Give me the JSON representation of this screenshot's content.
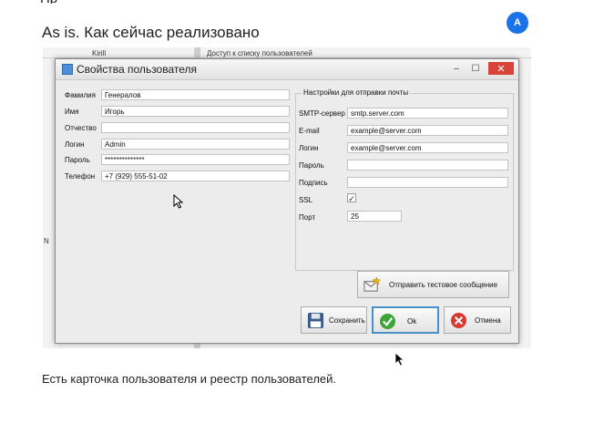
{
  "page": {
    "cutoff_text": "Пр",
    "heading": "As is. Как сейчас реализовано",
    "avatar_letter": "А",
    "caption": "Есть карточка пользователя и реестр пользователей."
  },
  "background": {
    "user_name": "Kirill",
    "column_title": "Доступ к списку пользователей",
    "left_char": "N"
  },
  "window": {
    "title": "Свойства пользователя",
    "minimize": "–",
    "maximize": "☐",
    "close": "✕"
  },
  "user": {
    "labels": {
      "last_name": "Фамилия",
      "first_name": "Имя",
      "patronymic": "Отчество",
      "login": "Логин",
      "password": "Пароль",
      "phone": "Телефон"
    },
    "values": {
      "last_name": "Генералов",
      "first_name": "Игорь",
      "patronymic": "",
      "login": "Admin",
      "password": "**************",
      "phone": "+7 (929) 555-51-02"
    }
  },
  "mail": {
    "group_title": "Настройки для отправки почты",
    "labels": {
      "smtp": "SMTP-сервер",
      "email": "E-mail",
      "login": "Логин",
      "password": "Пароль",
      "signature": "Подпись",
      "ssl": "SSL",
      "port": "Порт"
    },
    "values": {
      "smtp": "smtp.server.com",
      "email": "example@server.com",
      "login": "example@server.com",
      "password": "",
      "signature": "",
      "ssl_mark": "✓",
      "port": "25"
    },
    "test_button": "Отправить тестовое сообщение"
  },
  "buttons": {
    "save": "Сохранить",
    "ok": "Ok",
    "cancel": "Отмена"
  },
  "colors": {
    "accent": "#1a73e8",
    "close_button": "#d9433a",
    "ok_border": "#4a90c8"
  }
}
